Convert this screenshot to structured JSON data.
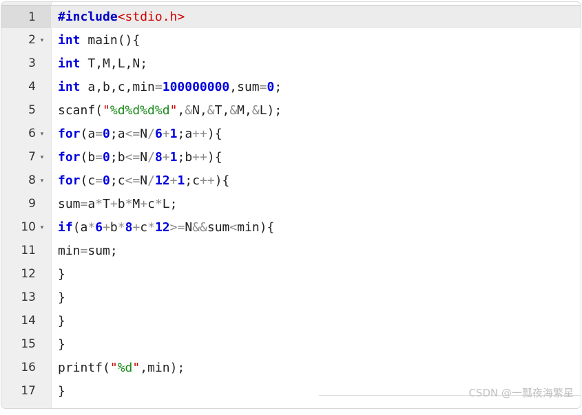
{
  "editor": {
    "language": "c",
    "active_line": 1,
    "colors": {
      "background": "#ffffff",
      "gutter": "#efefef",
      "active_line": "#ececec",
      "active_gutter": "#dcdcdc",
      "keyword": "#0000e0",
      "number": "#0000e0",
      "preprocessor": "#0000c8",
      "include_path": "#d00000",
      "string_quote": "#cc0000",
      "format_specifier": "#1a8a1a",
      "operator": "#8a8a8a",
      "identifier": "#222222",
      "watermark": "#c0c0c0"
    },
    "fold_marker": "▾",
    "lines": [
      {
        "number": "1",
        "foldable": false,
        "text": "#include<stdio.h>",
        "tokens": [
          {
            "t": "#include",
            "c": "t-pre"
          },
          {
            "t": "<stdio.h>",
            "c": "t-inc"
          }
        ]
      },
      {
        "number": "2",
        "foldable": true,
        "text": "int main(){",
        "tokens": [
          {
            "t": "int",
            "c": "t-kw"
          },
          {
            "t": " main(){",
            "c": "t-id"
          }
        ]
      },
      {
        "number": "3",
        "foldable": false,
        "text": "int T,M,L,N;",
        "tokens": [
          {
            "t": "int",
            "c": "t-kw"
          },
          {
            "t": " T,M,L,N;",
            "c": "t-id"
          }
        ]
      },
      {
        "number": "4",
        "foldable": false,
        "text": "int a,b,c,min=100000000,sum=0;",
        "tokens": [
          {
            "t": "int",
            "c": "t-kw"
          },
          {
            "t": " a,b,c,min",
            "c": "t-id"
          },
          {
            "t": "=",
            "c": "t-op"
          },
          {
            "t": "100000000",
            "c": "t-num"
          },
          {
            "t": ",sum",
            "c": "t-id"
          },
          {
            "t": "=",
            "c": "t-op"
          },
          {
            "t": "0",
            "c": "t-num"
          },
          {
            "t": ";",
            "c": "t-id"
          }
        ]
      },
      {
        "number": "5",
        "foldable": false,
        "text": "scanf(\"%d%d%d%d\",&N,&T,&M,&L);",
        "tokens": [
          {
            "t": "scanf(",
            "c": "t-id"
          },
          {
            "t": "\"",
            "c": "t-quote"
          },
          {
            "t": "%d%d%d%d",
            "c": "t-fmt"
          },
          {
            "t": "\"",
            "c": "t-quote"
          },
          {
            "t": ",",
            "c": "t-id"
          },
          {
            "t": "&",
            "c": "t-op"
          },
          {
            "t": "N,",
            "c": "t-id"
          },
          {
            "t": "&",
            "c": "t-op"
          },
          {
            "t": "T,",
            "c": "t-id"
          },
          {
            "t": "&",
            "c": "t-op"
          },
          {
            "t": "M,",
            "c": "t-id"
          },
          {
            "t": "&",
            "c": "t-op"
          },
          {
            "t": "L);",
            "c": "t-id"
          }
        ]
      },
      {
        "number": "6",
        "foldable": true,
        "text": "for(a=0;a<=N/6+1;a++){",
        "tokens": [
          {
            "t": "for",
            "c": "t-kw"
          },
          {
            "t": "(a",
            "c": "t-id"
          },
          {
            "t": "=",
            "c": "t-op"
          },
          {
            "t": "0",
            "c": "t-num"
          },
          {
            "t": ";a",
            "c": "t-id"
          },
          {
            "t": "<=",
            "c": "t-op"
          },
          {
            "t": "N",
            "c": "t-id"
          },
          {
            "t": "/",
            "c": "t-op"
          },
          {
            "t": "6",
            "c": "t-num"
          },
          {
            "t": "+",
            "c": "t-op"
          },
          {
            "t": "1",
            "c": "t-num"
          },
          {
            "t": ";a",
            "c": "t-id"
          },
          {
            "t": "++",
            "c": "t-op"
          },
          {
            "t": "){",
            "c": "t-id"
          }
        ]
      },
      {
        "number": "7",
        "foldable": true,
        "text": "for(b=0;b<=N/8+1;b++){",
        "tokens": [
          {
            "t": "for",
            "c": "t-kw"
          },
          {
            "t": "(b",
            "c": "t-id"
          },
          {
            "t": "=",
            "c": "t-op"
          },
          {
            "t": "0",
            "c": "t-num"
          },
          {
            "t": ";b",
            "c": "t-id"
          },
          {
            "t": "<=",
            "c": "t-op"
          },
          {
            "t": "N",
            "c": "t-id"
          },
          {
            "t": "/",
            "c": "t-op"
          },
          {
            "t": "8",
            "c": "t-num"
          },
          {
            "t": "+",
            "c": "t-op"
          },
          {
            "t": "1",
            "c": "t-num"
          },
          {
            "t": ";b",
            "c": "t-id"
          },
          {
            "t": "++",
            "c": "t-op"
          },
          {
            "t": "){",
            "c": "t-id"
          }
        ]
      },
      {
        "number": "8",
        "foldable": true,
        "text": "for(c=0;c<=N/12+1;c++){",
        "tokens": [
          {
            "t": "for",
            "c": "t-kw"
          },
          {
            "t": "(c",
            "c": "t-id"
          },
          {
            "t": "=",
            "c": "t-op"
          },
          {
            "t": "0",
            "c": "t-num"
          },
          {
            "t": ";c",
            "c": "t-id"
          },
          {
            "t": "<=",
            "c": "t-op"
          },
          {
            "t": "N",
            "c": "t-id"
          },
          {
            "t": "/",
            "c": "t-op"
          },
          {
            "t": "12",
            "c": "t-num"
          },
          {
            "t": "+",
            "c": "t-op"
          },
          {
            "t": "1",
            "c": "t-num"
          },
          {
            "t": ";c",
            "c": "t-id"
          },
          {
            "t": "++",
            "c": "t-op"
          },
          {
            "t": "){",
            "c": "t-id"
          }
        ]
      },
      {
        "number": "9",
        "foldable": false,
        "text": "sum=a*T+b*M+c*L;",
        "tokens": [
          {
            "t": "sum",
            "c": "t-id"
          },
          {
            "t": "=",
            "c": "t-op"
          },
          {
            "t": "a",
            "c": "t-id"
          },
          {
            "t": "*",
            "c": "t-op"
          },
          {
            "t": "T",
            "c": "t-id"
          },
          {
            "t": "+",
            "c": "t-op"
          },
          {
            "t": "b",
            "c": "t-id"
          },
          {
            "t": "*",
            "c": "t-op"
          },
          {
            "t": "M",
            "c": "t-id"
          },
          {
            "t": "+",
            "c": "t-op"
          },
          {
            "t": "c",
            "c": "t-id"
          },
          {
            "t": "*",
            "c": "t-op"
          },
          {
            "t": "L;",
            "c": "t-id"
          }
        ]
      },
      {
        "number": "10",
        "foldable": true,
        "text": "if(a*6+b*8+c*12>=N&&sum<min){",
        "tokens": [
          {
            "t": "if",
            "c": "t-kw"
          },
          {
            "t": "(a",
            "c": "t-id"
          },
          {
            "t": "*",
            "c": "t-op"
          },
          {
            "t": "6",
            "c": "t-num"
          },
          {
            "t": "+",
            "c": "t-op"
          },
          {
            "t": "b",
            "c": "t-id"
          },
          {
            "t": "*",
            "c": "t-op"
          },
          {
            "t": "8",
            "c": "t-num"
          },
          {
            "t": "+",
            "c": "t-op"
          },
          {
            "t": "c",
            "c": "t-id"
          },
          {
            "t": "*",
            "c": "t-op"
          },
          {
            "t": "12",
            "c": "t-num"
          },
          {
            "t": ">=",
            "c": "t-op"
          },
          {
            "t": "N",
            "c": "t-id"
          },
          {
            "t": "&&",
            "c": "t-op"
          },
          {
            "t": "sum",
            "c": "t-id"
          },
          {
            "t": "<",
            "c": "t-op"
          },
          {
            "t": "min",
            "c": "t-id"
          },
          {
            "t": "){",
            "c": "t-id"
          }
        ]
      },
      {
        "number": "11",
        "foldable": false,
        "text": "min=sum;",
        "tokens": [
          {
            "t": "min",
            "c": "t-id"
          },
          {
            "t": "=",
            "c": "t-op"
          },
          {
            "t": "sum;",
            "c": "t-id"
          }
        ]
      },
      {
        "number": "12",
        "foldable": false,
        "text": "}",
        "tokens": [
          {
            "t": "}",
            "c": "t-id"
          }
        ]
      },
      {
        "number": "13",
        "foldable": false,
        "text": "}",
        "tokens": [
          {
            "t": "}",
            "c": "t-id"
          }
        ]
      },
      {
        "number": "14",
        "foldable": false,
        "text": "}",
        "tokens": [
          {
            "t": "}",
            "c": "t-id"
          }
        ]
      },
      {
        "number": "15",
        "foldable": false,
        "text": "}",
        "tokens": [
          {
            "t": "}",
            "c": "t-id"
          }
        ]
      },
      {
        "number": "16",
        "foldable": false,
        "text": "printf(\"%d\",min);",
        "tokens": [
          {
            "t": "printf(",
            "c": "t-id"
          },
          {
            "t": "\"",
            "c": "t-quote"
          },
          {
            "t": "%d",
            "c": "t-fmt"
          },
          {
            "t": "\"",
            "c": "t-quote"
          },
          {
            "t": ",min);",
            "c": "t-id"
          }
        ]
      },
      {
        "number": "17",
        "foldable": false,
        "text": "}",
        "tokens": [
          {
            "t": "}",
            "c": "t-id"
          }
        ]
      }
    ]
  },
  "watermark": {
    "text": "CSDN @一瓢夜海繁星"
  }
}
